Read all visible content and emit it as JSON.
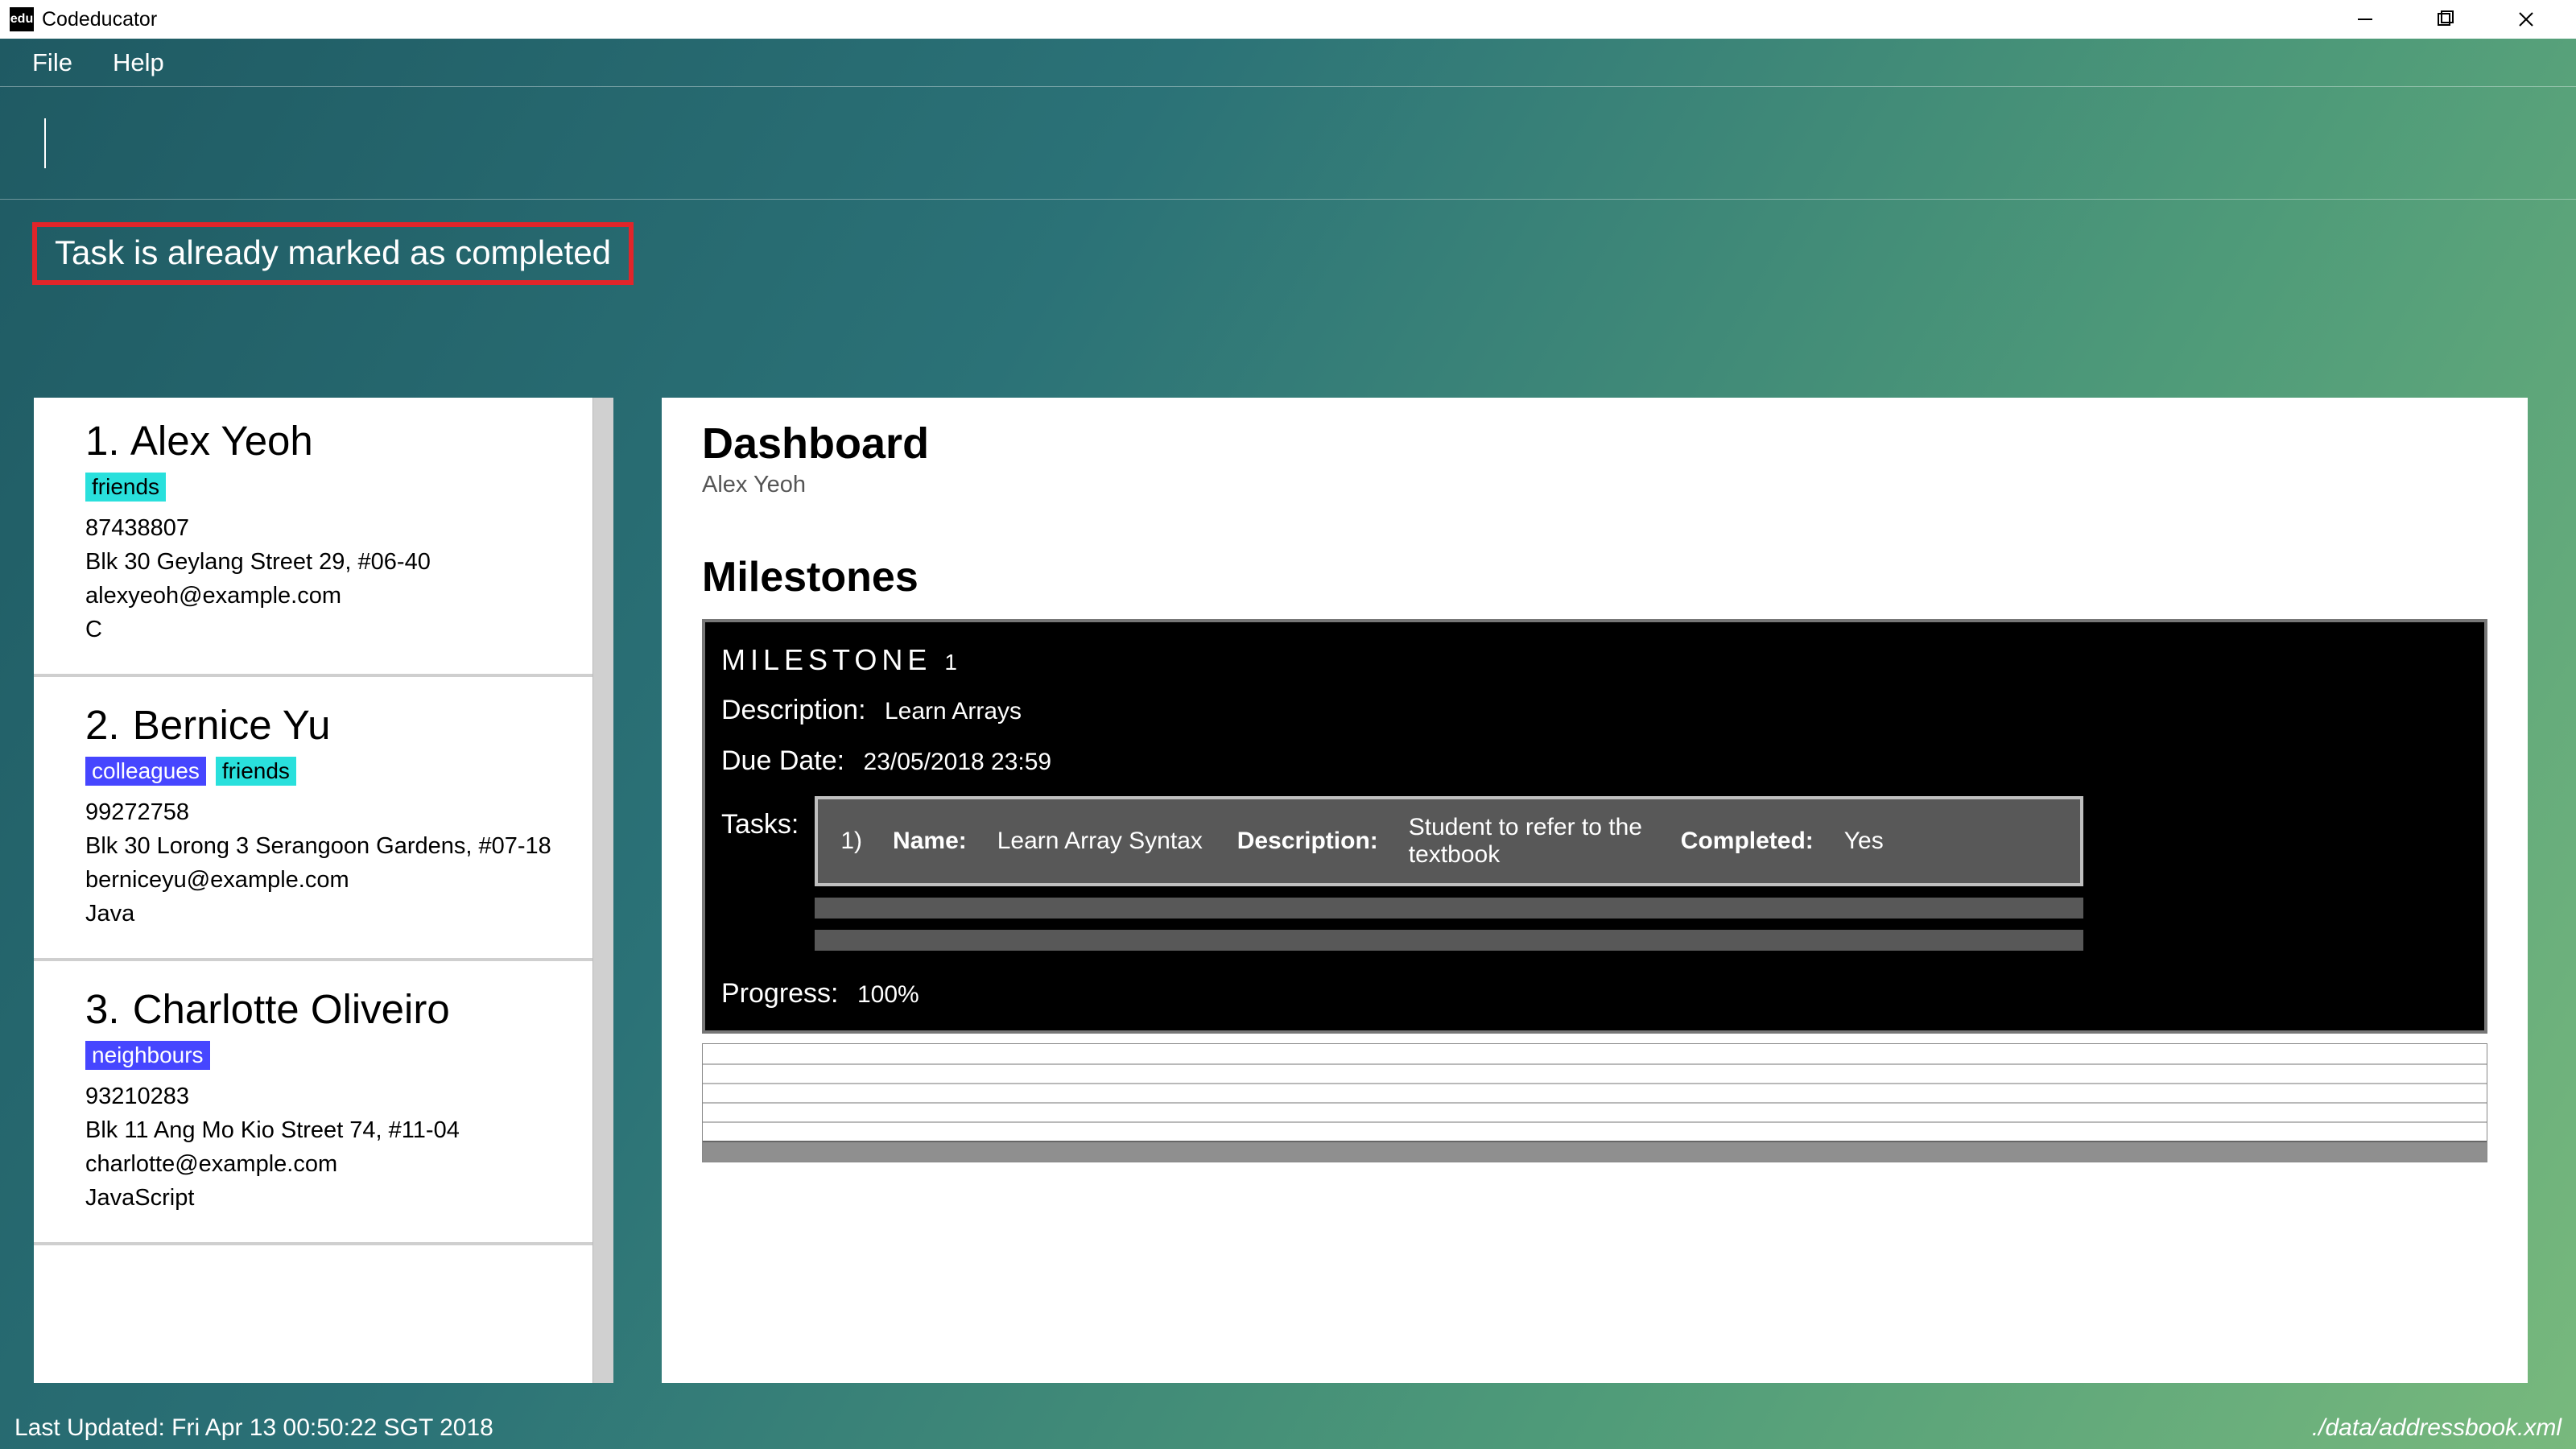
{
  "window": {
    "title": "Codeducator",
    "icon_label": "edu"
  },
  "menu": {
    "file": "File",
    "help": "Help"
  },
  "status_message": "Task is already marked as completed",
  "persons": [
    {
      "index": "1.",
      "name": "Alex Yeoh",
      "tags": [
        {
          "text": "friends",
          "cls": "friends"
        }
      ],
      "phone": "87438807",
      "address": "Blk 30 Geylang Street 29, #06-40",
      "email": "alexyeoh@example.com",
      "lang": "C"
    },
    {
      "index": "2.",
      "name": "Bernice Yu",
      "tags": [
        {
          "text": "colleagues",
          "cls": "colleagues"
        },
        {
          "text": "friends",
          "cls": "friends"
        }
      ],
      "phone": "99272758",
      "address": "Blk 30 Lorong 3 Serangoon Gardens, #07-18",
      "email": "berniceyu@example.com",
      "lang": "Java"
    },
    {
      "index": "3.",
      "name": "Charlotte Oliveiro",
      "tags": [
        {
          "text": "neighbours",
          "cls": "neighbours"
        }
      ],
      "phone": "93210283",
      "address": "Blk 11 Ang Mo Kio Street 74, #11-04",
      "email": "charlotte@example.com",
      "lang": "JavaScript"
    }
  ],
  "dashboard": {
    "title": "Dashboard",
    "subtitle": "Alex Yeoh",
    "milestones_header": "Milestones",
    "milestone": {
      "heading_prefix": "MILESTONE",
      "heading_num": "1",
      "desc_label": "Description:",
      "desc_value": "Learn Arrays",
      "due_label": "Due Date:",
      "due_value": "23/05/2018 23:59",
      "tasks_label": "Tasks:",
      "task": {
        "idx": "1)",
        "name_label": "Name:",
        "name_value": "Learn Array Syntax",
        "desc_label": "Description:",
        "desc_value": "Student to refer to the textbook",
        "comp_label": "Completed:",
        "comp_value": "Yes"
      },
      "progress_label": "Progress:",
      "progress_value": "100%"
    }
  },
  "footer": {
    "left": "Last Updated: Fri Apr 13 00:50:22 SGT 2018",
    "right": "./data/addressbook.xml"
  }
}
